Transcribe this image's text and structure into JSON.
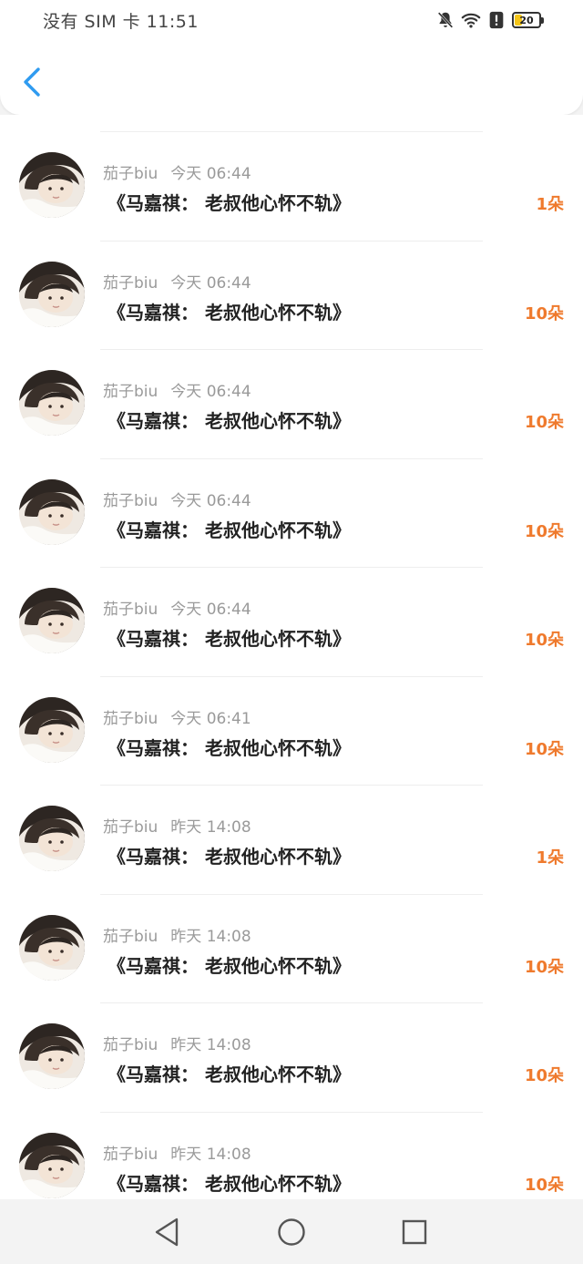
{
  "status_bar": {
    "left_text": "没有 SIM 卡 11:51",
    "icons": [
      "bell-muted-icon",
      "wifi-icon",
      "alert-icon"
    ],
    "battery_level": "20",
    "battery_color": "#f5c518"
  },
  "header": {
    "back_icon": "chevron-left-icon",
    "accent_color": "#2f9bf0"
  },
  "gifts": [
    {
      "name": "茄子biu",
      "time": "今天 06:44",
      "title": "《马嘉祺： 老叔他心怀不轨》",
      "amount": "1朵"
    },
    {
      "name": "茄子biu",
      "time": "今天 06:44",
      "title": "《马嘉祺： 老叔他心怀不轨》",
      "amount": "10朵"
    },
    {
      "name": "茄子biu",
      "time": "今天 06:44",
      "title": "《马嘉祺： 老叔他心怀不轨》",
      "amount": "10朵"
    },
    {
      "name": "茄子biu",
      "time": "今天 06:44",
      "title": "《马嘉祺： 老叔他心怀不轨》",
      "amount": "10朵"
    },
    {
      "name": "茄子biu",
      "time": "今天 06:44",
      "title": "《马嘉祺： 老叔他心怀不轨》",
      "amount": "10朵"
    },
    {
      "name": "茄子biu",
      "time": "今天 06:41",
      "title": "《马嘉祺： 老叔他心怀不轨》",
      "amount": "10朵"
    },
    {
      "name": "茄子biu",
      "time": "昨天 14:08",
      "title": "《马嘉祺： 老叔他心怀不轨》",
      "amount": "1朵"
    },
    {
      "name": "茄子biu",
      "time": "昨天 14:08",
      "title": "《马嘉祺： 老叔他心怀不轨》",
      "amount": "10朵"
    },
    {
      "name": "茄子biu",
      "time": "昨天 14:08",
      "title": "《马嘉祺： 老叔他心怀不轨》",
      "amount": "10朵"
    },
    {
      "name": "茄子biu",
      "time": "昨天 14:08",
      "title": "《马嘉祺： 老叔他心怀不轨》",
      "amount": "10朵"
    }
  ],
  "amount_color": "#ef7a2d",
  "nav_bar": {
    "buttons": [
      "back-triangle-icon",
      "home-circle-icon",
      "recents-square-icon"
    ]
  }
}
